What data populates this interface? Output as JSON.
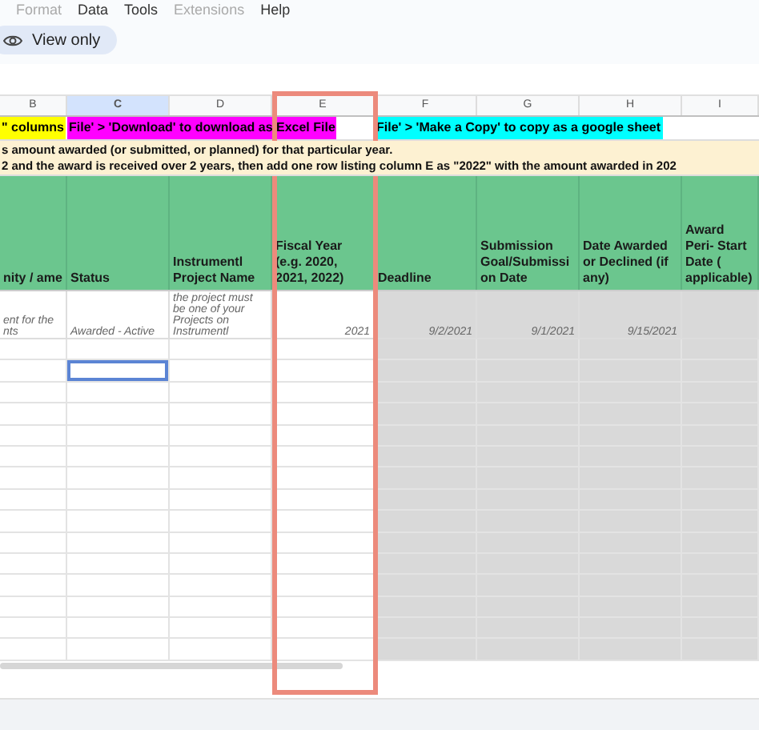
{
  "menu": [
    "Format",
    "Data",
    "Tools",
    "Extensions",
    "Help"
  ],
  "menu_disabled": [
    true,
    false,
    false,
    true,
    false
  ],
  "view_only": {
    "label": "View only"
  },
  "columns": [
    {
      "letter": "B",
      "selected": false,
      "shaded": false
    },
    {
      "letter": "C",
      "selected": true,
      "shaded": false
    },
    {
      "letter": "D",
      "selected": false,
      "shaded": false
    },
    {
      "letter": "E",
      "selected": false,
      "shaded": false,
      "highlighted": true
    },
    {
      "letter": "F",
      "selected": false,
      "shaded": true
    },
    {
      "letter": "G",
      "selected": false,
      "shaded": true
    },
    {
      "letter": "H",
      "selected": false,
      "shaded": true
    },
    {
      "letter": "I",
      "selected": false,
      "shaded": true
    }
  ],
  "banner": [
    {
      "text": "\" columns",
      "color": "#ffff00"
    },
    {
      "text": "File' > 'Download' to download as Excel File",
      "color": "#ff00ff"
    },
    {
      "text": "File' > 'Make a Copy' to copy as a google sheet",
      "color": "#00ffff"
    }
  ],
  "notes": [
    "s amount awarded (or submitted, or planned) for that particular year.",
    "2 and the award is received over 2 years, then add one row listing column E as \"2022\" with the amount awarded in 202"
  ],
  "headers": [
    "nity / ame",
    "Status",
    "Instrumentl Project Name",
    "Fiscal Year (e.g. 2020, 2021, 2022)",
    "Deadline",
    "Submission Goal/Submissi on Date",
    "Date Awarded or Declined (if any)",
    "Award Peri- Start Date ( applicable)"
  ],
  "example_row": [
    {
      "text": "ent for the nts",
      "kind": "note"
    },
    {
      "text": "Awarded - Active",
      "kind": "note"
    },
    {
      "text": "the project must be one of your Projects on Instrumentl",
      "kind": "note"
    },
    {
      "text": "2021",
      "kind": "value"
    },
    {
      "text": "9/2/2021",
      "kind": "value"
    },
    {
      "text": "9/1/2021",
      "kind": "value"
    },
    {
      "text": "9/15/2021",
      "kind": "value"
    }
  ]
}
